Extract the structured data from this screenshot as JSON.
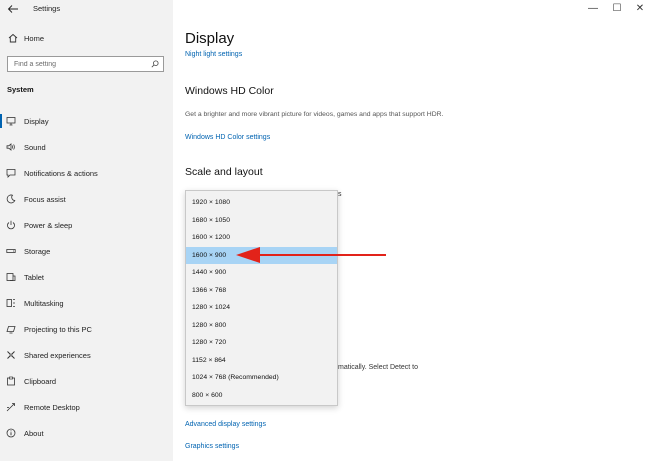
{
  "window": {
    "title": "Settings",
    "back_icon": "arrow-left-icon",
    "minimize": "—",
    "maximize": "☐",
    "close": "✕"
  },
  "sidebar": {
    "home_label": "Home",
    "search_placeholder": "Find a setting",
    "section": "System",
    "items": [
      {
        "label": "Display",
        "icon": "monitor-icon",
        "selected": true
      },
      {
        "label": "Sound",
        "icon": "speaker-icon"
      },
      {
        "label": "Notifications & actions",
        "icon": "notification-icon"
      },
      {
        "label": "Focus assist",
        "icon": "moon-icon"
      },
      {
        "label": "Power & sleep",
        "icon": "power-icon"
      },
      {
        "label": "Storage",
        "icon": "storage-icon"
      },
      {
        "label": "Tablet",
        "icon": "tablet-icon"
      },
      {
        "label": "Multitasking",
        "icon": "multitasking-icon"
      },
      {
        "label": "Projecting to this PC",
        "icon": "projector-icon"
      },
      {
        "label": "Shared experiences",
        "icon": "shared-icon"
      },
      {
        "label": "Clipboard",
        "icon": "clipboard-icon"
      },
      {
        "label": "Remote Desktop",
        "icon": "remote-icon"
      },
      {
        "label": "About",
        "icon": "info-icon"
      }
    ]
  },
  "main": {
    "title": "Display",
    "night_light_link": "Night light settings",
    "hd_color_heading": "Windows HD Color",
    "hd_color_desc": "Get a brighter and more vibrant picture for videos, games and apps that support HDR.",
    "hd_color_link": "Windows HD Color settings",
    "scale_heading": "Scale and layout",
    "partial_s": "s",
    "partial_detect_text": "matically. Select Detect to",
    "advanced_link": "Advanced display settings",
    "graphics_link": "Graphics settings"
  },
  "resolution_dropdown": {
    "options": [
      "1920 × 1080",
      "1680 × 1050",
      "1600 × 1200",
      "1600 × 900",
      "1440 × 900",
      "1366 × 768",
      "1280 × 1024",
      "1280 × 800",
      "1280 × 720",
      "1152 × 864",
      "1024 × 768 (Recommended)",
      "800 × 600"
    ],
    "selected": "1600 × 900"
  },
  "colors": {
    "accent": "#0063b1",
    "selected_option": "#a8d4f5",
    "annotation_arrow": "#e2231a"
  }
}
